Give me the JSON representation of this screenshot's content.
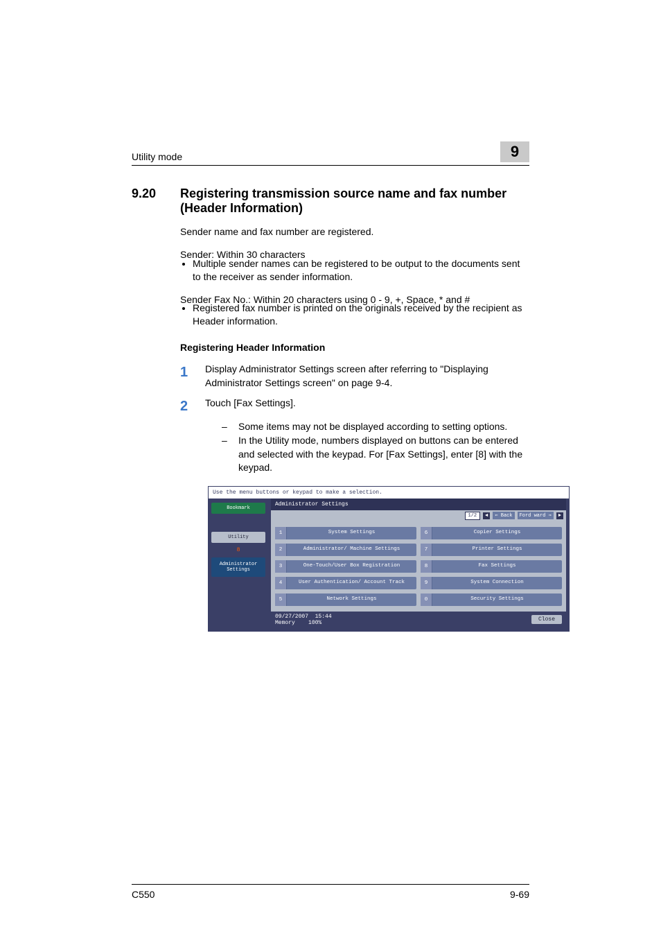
{
  "header": {
    "left": "Utility mode",
    "chapter": "9"
  },
  "section": {
    "number": "9.20",
    "title": "Registering transmission source name and fax number (Header Information)"
  },
  "paras": {
    "p1": "Sender name and fax number are registered.",
    "p2": "Sender: Within 30 characters",
    "p2_bullet": "Multiple sender names can be registered to be output to the documents sent to the receiver as sender information.",
    "p3": "Sender Fax No.: Within 20 characters using 0 - 9, +, Space, * and #",
    "p3_bullet": "Registered fax number is printed on the originals received by the recipient as Header information."
  },
  "subhead": "Registering Header Information",
  "steps": {
    "s1_num": "1",
    "s1": "Display Administrator Settings screen after referring to \"Displaying Administrator Settings screen\" on page 9-4.",
    "s2_num": "2",
    "s2": "Touch [Fax Settings].",
    "s2_sub1": "Some items may not be displayed according to setting options.",
    "s2_sub2": "In the Utility mode, numbers displayed on buttons can be entered and selected with the keypad. For [Fax Settings], enter [8] with the keypad."
  },
  "screenshot": {
    "topbar": "Use the menu buttons or keypad to make a selection.",
    "side": {
      "bookmark": "Bookmark",
      "utility": "Utility",
      "num": "8",
      "admin": "Administrator Settings"
    },
    "band": "Administrator Settings",
    "nav": {
      "page": "1/2",
      "back": "Back",
      "fwd": "Ford ward"
    },
    "menu": [
      {
        "n": "1",
        "l": "System Settings"
      },
      {
        "n": "6",
        "l": "Copier Settings"
      },
      {
        "n": "2",
        "l": "Administrator/ Machine Settings"
      },
      {
        "n": "7",
        "l": "Printer Settings"
      },
      {
        "n": "3",
        "l": "One-Touch/User Box Registration"
      },
      {
        "n": "8",
        "l": "Fax Settings"
      },
      {
        "n": "4",
        "l": "User Authentication/ Account Track"
      },
      {
        "n": "9",
        "l": "System Connection"
      },
      {
        "n": "5",
        "l": "Network Settings"
      },
      {
        "n": "0",
        "l": "Security Settings"
      }
    ],
    "foot": {
      "date": "09/27/2007",
      "time": "15:44",
      "mem_label": "Memory",
      "mem_val": "100%",
      "close": "Close"
    }
  },
  "footer": {
    "left": "C550",
    "right": "9-69"
  }
}
